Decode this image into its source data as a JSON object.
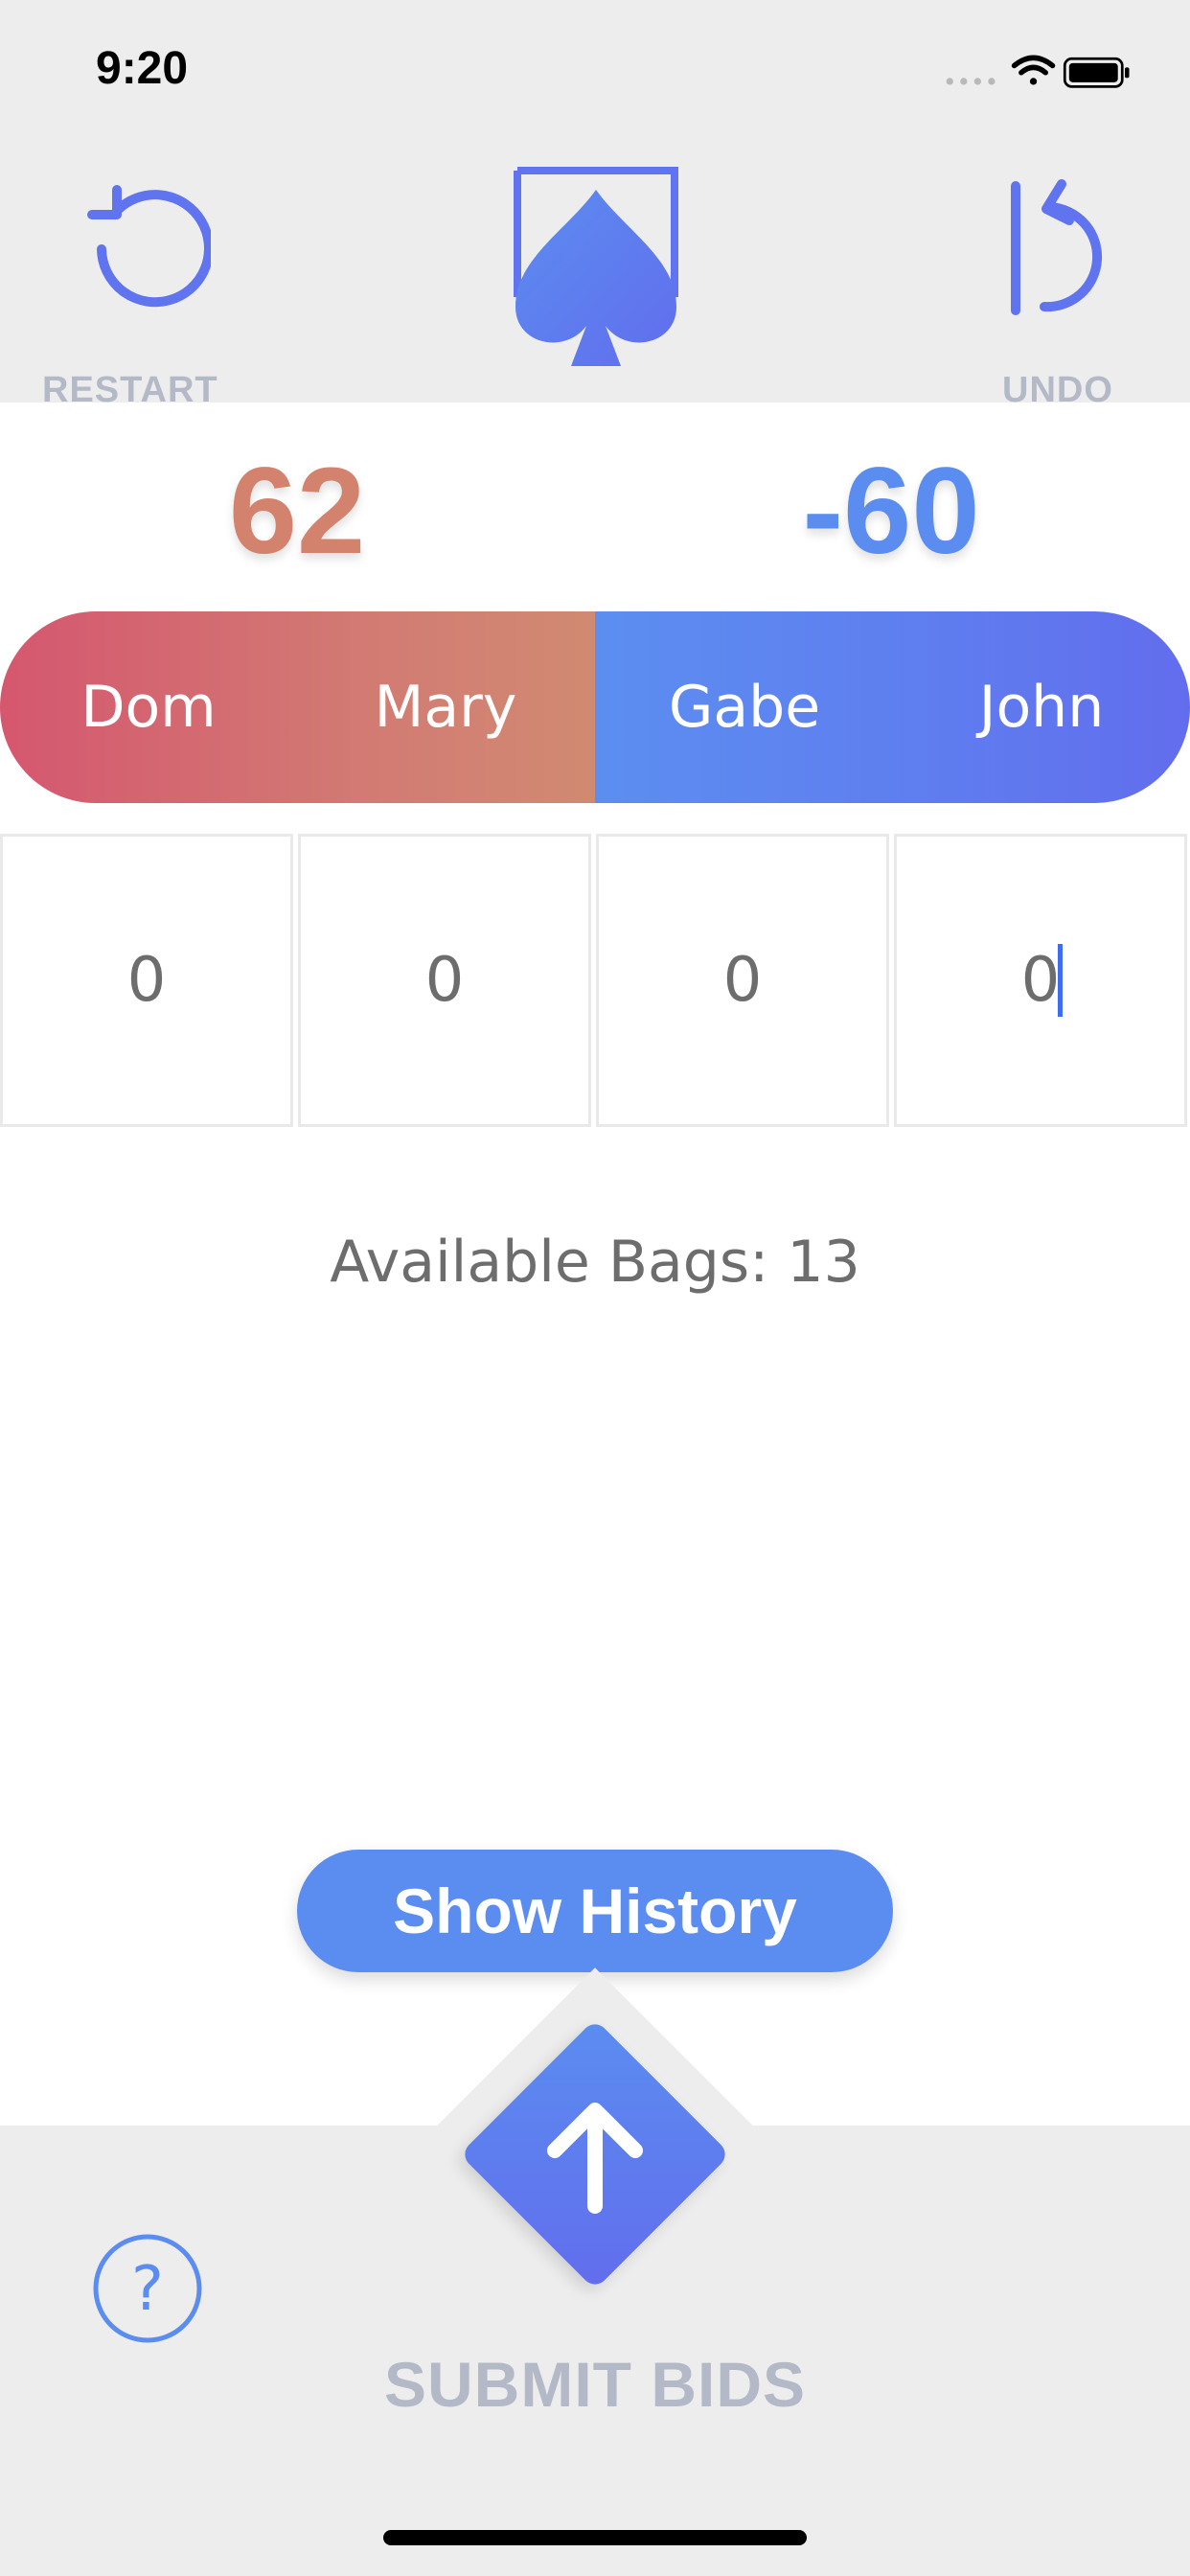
{
  "status_bar": {
    "time": "9:20"
  },
  "toolbar": {
    "restart_label": "RESTART",
    "undo_label": "UNDO"
  },
  "scores": {
    "team_left": "62",
    "team_right": "-60"
  },
  "players": [
    "Dom",
    "Mary",
    "Gabe",
    "John"
  ],
  "bids": [
    "0",
    "0",
    "0",
    "0"
  ],
  "bags": {
    "text": "Available Bags: 13"
  },
  "history_button": {
    "label": "Show History"
  },
  "submit": {
    "label": "SUBMIT BIDS"
  },
  "help": {
    "glyph": "?"
  },
  "colors": {
    "accent_blue": "#5b8df0",
    "accent_red": "#d5576f",
    "score_left": "#d3826d",
    "muted_label": "#b3b9c6"
  },
  "icons": [
    "restart-icon",
    "spade-logo-icon",
    "undo-icon",
    "help-icon",
    "arrow-up-icon"
  ]
}
